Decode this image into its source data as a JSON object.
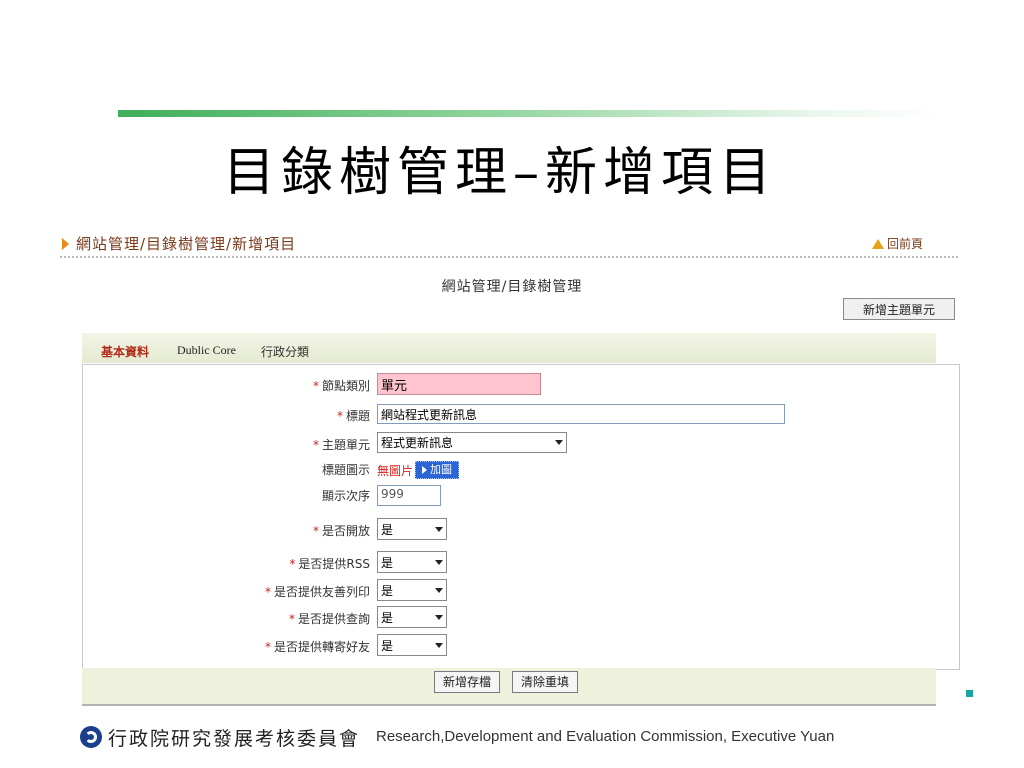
{
  "slide": {
    "title": "目錄樹管理–新增項目",
    "footer_cn": "行政院研究發展考核委員會",
    "footer_en": "Research,Development and Evaluation Commission, Executive Yuan"
  },
  "breadcrumb": "網站管理/目錄樹管理/新增項目",
  "back_label": "回前頁",
  "center_path": "網站管理/目錄樹管理",
  "add_unit_button": "新增主題單元",
  "tabs": [
    "基本資料",
    "Dublic Core",
    "行政分類"
  ],
  "form": {
    "node_type": {
      "label": "節點類別",
      "value": "單元",
      "required": true
    },
    "title": {
      "label": "標題",
      "value": "網站程式更新訊息",
      "required": true
    },
    "topic_unit": {
      "label": "主題單元",
      "value": "程式更新訊息",
      "required": true
    },
    "title_icon": {
      "label": "標題圖示",
      "no_image": "無圖片",
      "add_button": "加圖"
    },
    "display_order": {
      "label": "顯示次序",
      "value": "999"
    },
    "is_open": {
      "label": "是否開放",
      "value": "是",
      "required": true
    },
    "provide_rss": {
      "label": "是否提供RSS",
      "value": "是",
      "required": true
    },
    "provide_print": {
      "label": "是否提供友善列印",
      "value": "是",
      "required": true
    },
    "provide_query": {
      "label": "是否提供查詢",
      "value": "是",
      "required": true
    },
    "provide_forward": {
      "label": "是否提供轉寄好友",
      "value": "是",
      "required": true
    },
    "star": "*"
  },
  "buttons": {
    "save": "新增存檔",
    "reset": "清除重填"
  },
  "colors": {
    "accent_green": "#3fae5a",
    "crumb": "#7a3b1b",
    "required": "#cc2222",
    "pink_field": "#ffc4cf"
  },
  "icons": {
    "crumb": "triangle-right-icon",
    "back": "home-icon",
    "logo": "rdec-logo-icon"
  }
}
